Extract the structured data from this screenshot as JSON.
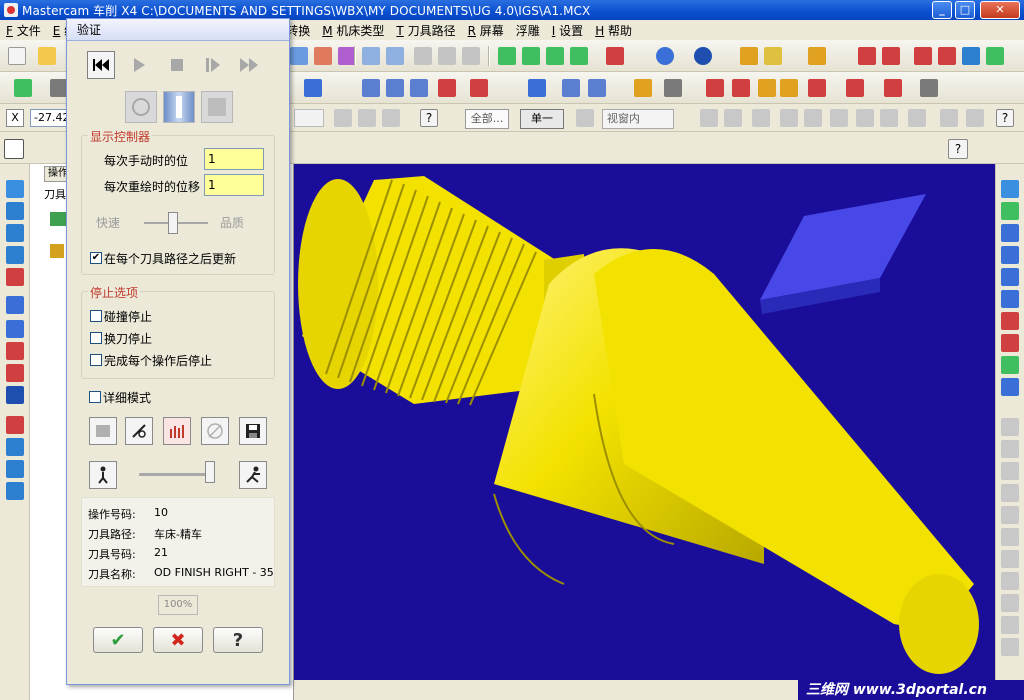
{
  "window": {
    "title": "Mastercam 车削  X4  C:\\DOCUMENTS AND SETTINGS\\WBX\\MY DOCUMENTS\\UG 4.0\\IGS\\A1.MCX",
    "minimize": "_",
    "maximize": "□",
    "close": "✕"
  },
  "menu": [
    {
      "key": "F",
      "label": "文件"
    },
    {
      "key": "E",
      "label": "编辑"
    },
    {
      "key": "",
      "label": "转换"
    },
    {
      "key": "M",
      "label": "机床类型"
    },
    {
      "key": "T",
      "label": "刀具路径"
    },
    {
      "key": "R",
      "label": "屏幕"
    },
    {
      "key": "",
      "label": "浮雕"
    },
    {
      "key": "I",
      "label": "设置"
    },
    {
      "key": "H",
      "label": "帮助"
    }
  ],
  "ribbon": {
    "coord_x_label": "X",
    "coord_x_value": "-27.422",
    "all_button": "全部...",
    "single_button": "单一",
    "view_dropdown": "视窗内"
  },
  "ops_manager": {
    "tab": "操作",
    "label": "刀具"
  },
  "dialog": {
    "title": "验证",
    "close": "✕",
    "display_group": "显示控制器",
    "step_manual_label": "每次手动时的位",
    "step_manual_value": "1",
    "step_redraw_label": "每次重绘时的位移",
    "step_redraw_value": "1",
    "speed_label": "快速",
    "quality_label": "品质",
    "update_each_path": "在每个刀具路径之后更新",
    "update_each_path_checked": true,
    "stop_group": "停止选项",
    "stop_collision": "碰撞停止",
    "stop_tool_change": "换刀停止",
    "stop_each_op": "完成每个操作后停止",
    "verbose_mode": "详细模式",
    "info": {
      "op_number_label": "操作号码:",
      "op_number_value": "10",
      "toolpath_label": "刀具路径:",
      "toolpath_value": "车床-精车",
      "tool_number_label": "刀具号码:",
      "tool_number_value": "21",
      "tool_name_label": "刀具名称:",
      "tool_name_value": "OD FINISH RIGHT - 35"
    },
    "progress": "100%",
    "ok": "✔",
    "cancel": "✖",
    "help": "?"
  },
  "watermark": "三维网 www.3dportal.cn",
  "colors": {
    "viewport_bg": "#1a0d99",
    "part": "#f3e200",
    "tool_insert": "#4848e8",
    "input_highlight": "#ffff99",
    "group_title": "#c0392b"
  }
}
